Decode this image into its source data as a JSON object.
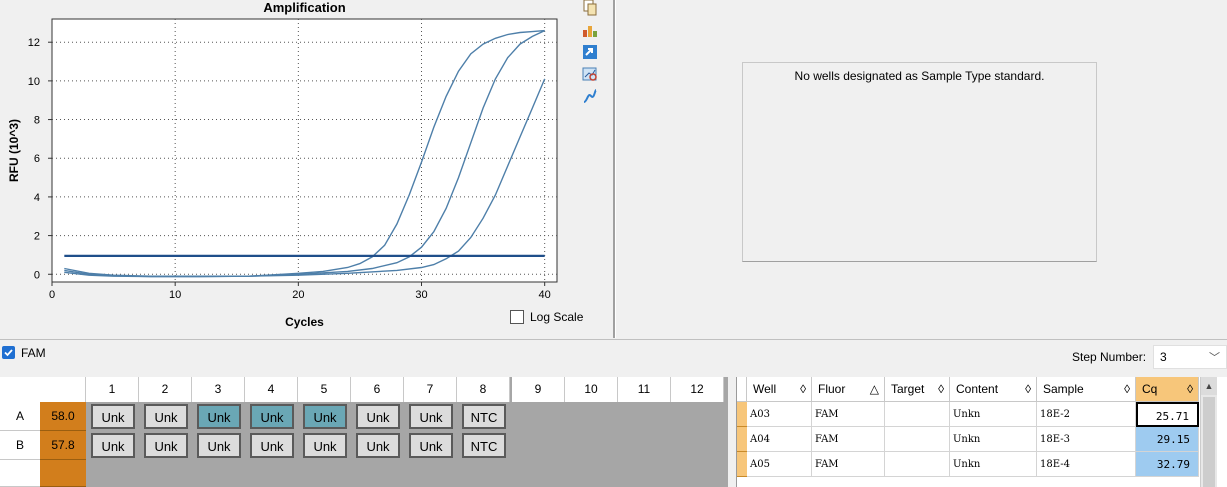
{
  "chart_data": {
    "type": "line",
    "title": "Amplification",
    "xlabel": "Cycles",
    "ylabel": "RFU (10^3)",
    "xlim": [
      0,
      41
    ],
    "ylim": [
      -0.4,
      13.2
    ],
    "x_ticks": [
      0,
      10,
      20,
      30,
      40
    ],
    "y_ticks": [
      0,
      2,
      4,
      6,
      8,
      10,
      12
    ],
    "grid": true,
    "threshold": 0.95,
    "series": [
      {
        "x": [
          1,
          3,
          5,
          8,
          12,
          16,
          20,
          22,
          24,
          25,
          26,
          27,
          28,
          29,
          30,
          31,
          32,
          33,
          34,
          35,
          36,
          37,
          38,
          39,
          40
        ],
        "y": [
          0.3,
          0.05,
          -0.05,
          -0.1,
          -0.1,
          -0.1,
          0.05,
          0.15,
          0.35,
          0.55,
          0.9,
          1.5,
          2.6,
          4.1,
          5.8,
          7.6,
          9.2,
          10.5,
          11.4,
          11.9,
          12.2,
          12.4,
          12.5,
          12.55,
          12.6
        ]
      },
      {
        "x": [
          1,
          3,
          5,
          8,
          12,
          16,
          20,
          24,
          26,
          28,
          29,
          30,
          31,
          32,
          33,
          34,
          35,
          36,
          37,
          38,
          39,
          40
        ],
        "y": [
          0.2,
          0.0,
          -0.08,
          -0.12,
          -0.12,
          -0.1,
          0.0,
          0.15,
          0.3,
          0.6,
          0.9,
          1.4,
          2.2,
          3.4,
          5.0,
          6.8,
          8.6,
          10.1,
          11.2,
          11.9,
          12.3,
          12.6
        ]
      },
      {
        "x": [
          1,
          3,
          5,
          8,
          12,
          16,
          20,
          24,
          28,
          30,
          31,
          32,
          33,
          34,
          35,
          36,
          37,
          38,
          39,
          40
        ],
        "y": [
          0.1,
          -0.05,
          -0.1,
          -0.12,
          -0.12,
          -0.1,
          -0.05,
          0.05,
          0.2,
          0.35,
          0.5,
          0.8,
          1.2,
          1.9,
          2.9,
          4.1,
          5.6,
          7.1,
          8.6,
          10.1
        ]
      }
    ]
  },
  "log_scale": {
    "label": "Log Scale",
    "checked": false
  },
  "toolbar_icons": [
    "copy-icon",
    "chart-settings-icon",
    "export-icon",
    "zoom-icon",
    "curve-icon"
  ],
  "standard_curve": {
    "message": "No wells designated as Sample Type standard."
  },
  "fluor": {
    "name": "FAM",
    "checked": true
  },
  "step": {
    "label": "Step Number:",
    "value": "3"
  },
  "plate": {
    "columns": [
      "1",
      "2",
      "3",
      "4",
      "5",
      "6",
      "7",
      "8",
      "9",
      "10",
      "11",
      "12"
    ],
    "rows": [
      {
        "label": "A",
        "temp": "58.0",
        "wells": [
          "Unk",
          "Unk",
          "Unk",
          "Unk",
          "Unk",
          "Unk",
          "Unk",
          "NTC"
        ],
        "selected": [
          2,
          3,
          4
        ]
      },
      {
        "label": "B",
        "temp": "57.8",
        "wells": [
          "Unk",
          "Unk",
          "Unk",
          "Unk",
          "Unk",
          "Unk",
          "Unk",
          "NTC"
        ],
        "selected": []
      }
    ]
  },
  "results": {
    "headers": [
      {
        "label": "Well",
        "sort": "◊"
      },
      {
        "label": "Fluor",
        "sort": "△"
      },
      {
        "label": "Target",
        "sort": "◊"
      },
      {
        "label": "Content",
        "sort": "◊"
      },
      {
        "label": "Sample",
        "sort": "◊"
      },
      {
        "label": "Cq",
        "sort": "◊"
      }
    ],
    "rows": [
      {
        "well": "A03",
        "fluor": "FAM",
        "target": "",
        "content": "Unkn",
        "sample": "18E-2",
        "cq": "25.71"
      },
      {
        "well": "A04",
        "fluor": "FAM",
        "target": "",
        "content": "Unkn",
        "sample": "18E-3",
        "cq": "29.15"
      },
      {
        "well": "A05",
        "fluor": "FAM",
        "target": "",
        "content": "Unkn",
        "sample": "18E-4",
        "cq": "32.79"
      }
    ]
  },
  "colors": {
    "curve": "#4e7fa9",
    "threshold": "#1f4e8a",
    "selected_well": "#6aa7b5",
    "temp": "#d27e1c",
    "cq_header": "#f7c67a"
  }
}
